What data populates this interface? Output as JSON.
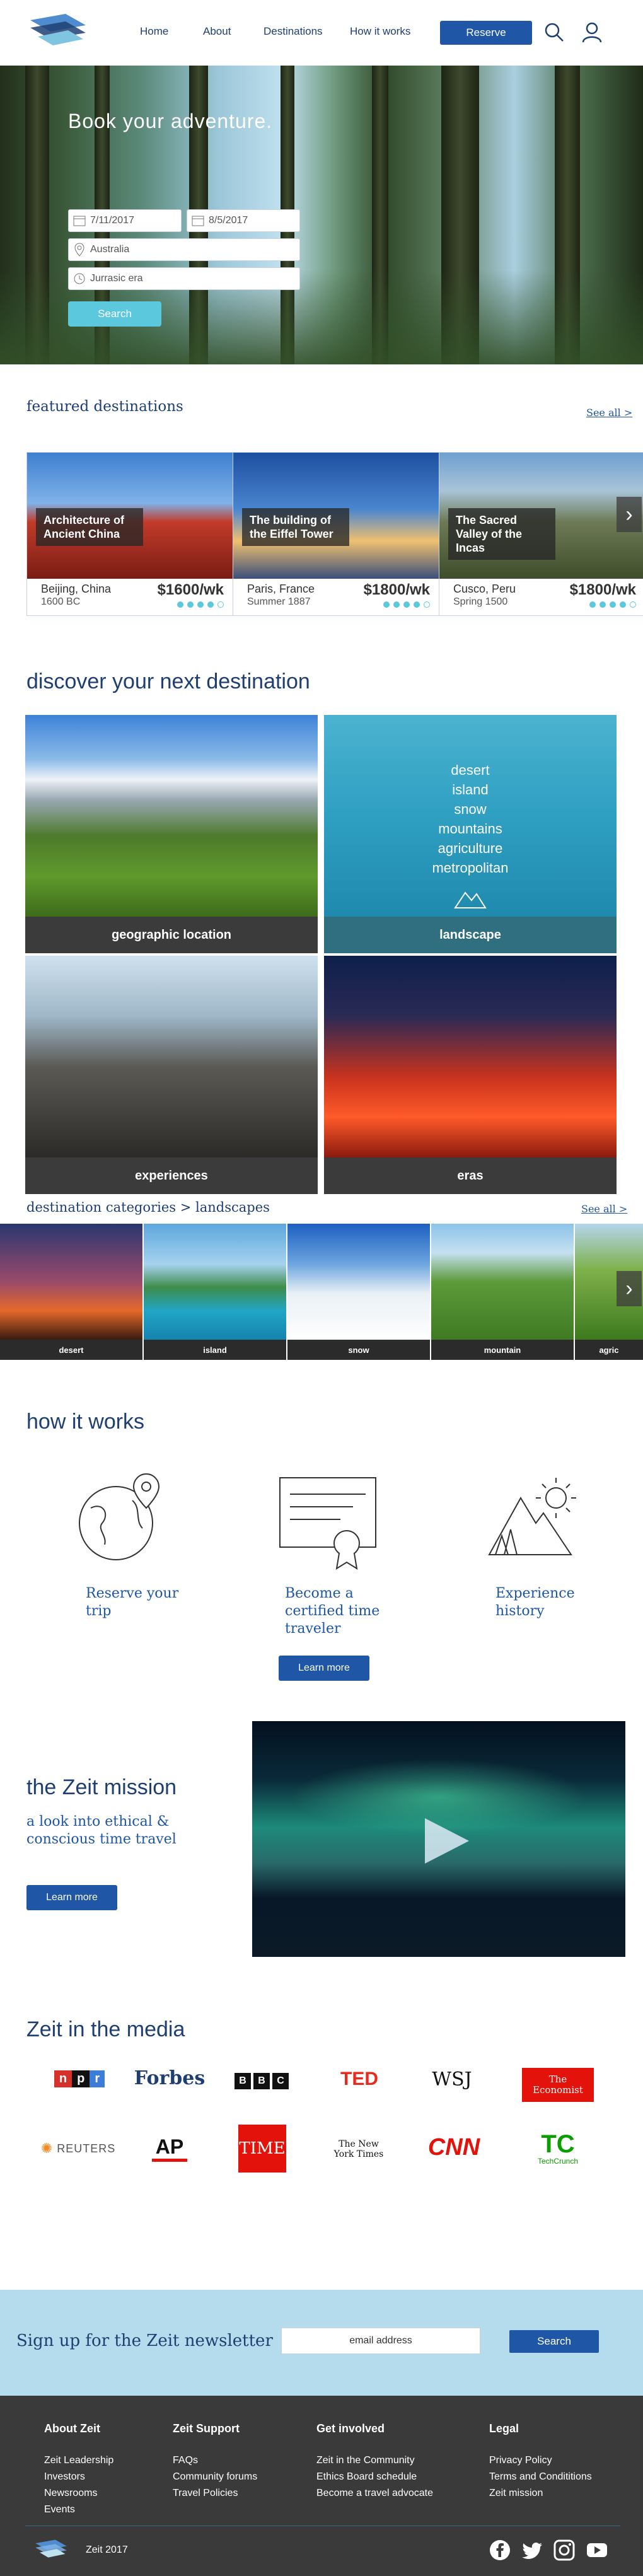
{
  "header": {
    "nav": [
      "Home",
      "About",
      "Destinations",
      "How it works"
    ],
    "reserve_label": "Reserve"
  },
  "hero": {
    "title": "Book your adventure.",
    "date_from": "7/11/2017",
    "date_to": "8/5/2017",
    "location_placeholder": "Australia",
    "era_placeholder": "Jurrasic era",
    "search_label": "Search"
  },
  "featured": {
    "heading": "featured destinations",
    "see_all": "See all >",
    "cards": [
      {
        "caption": "Architecture of Ancient China",
        "place": "Beijing, China",
        "era": "1600 BC",
        "price": "$1600/wk",
        "rating": 4,
        "rating_max": 5
      },
      {
        "caption": "The building of the Eiffel Tower",
        "place": "Paris, France",
        "era": "Summer 1887",
        "price": "$1800/wk",
        "rating": 4,
        "rating_max": 5
      },
      {
        "caption": "The Sacred Valley of the Incas",
        "place": "Cusco, Peru",
        "era": "Spring 1500",
        "price": "$1800/wk",
        "rating": 4,
        "rating_max": 5
      }
    ]
  },
  "discover": {
    "heading": "discover your next destination",
    "tiles": [
      "geographic location",
      "landscape",
      "experiences",
      "eras"
    ],
    "landscape_options": [
      "desert",
      "island",
      "snow",
      "mountains",
      "agriculture",
      "metropolitan"
    ]
  },
  "categories": {
    "breadcrumb": "destination categories > landscapes",
    "see_all": "See all >",
    "items": [
      "desert",
      "island",
      "snow",
      "mountain",
      "agric"
    ]
  },
  "how": {
    "heading": "how it works",
    "steps": [
      "Reserve your trip",
      "Become a certified time traveler",
      "Experience history"
    ],
    "learn_more": "Learn more"
  },
  "mission": {
    "heading": "the Zeit mission",
    "subheading": "a look into  ethical & conscious time travel",
    "learn_more": "Learn more"
  },
  "media": {
    "heading": "Zeit in the media",
    "logos": [
      "npr",
      "Forbes",
      "BBC",
      "TED",
      "WSJ",
      "The Economist",
      "REUTERS",
      "AP",
      "TIME",
      "The New York Times",
      "CNN",
      "TechCrunch"
    ]
  },
  "newsletter": {
    "heading": "Sign up for the Zeit newsletter",
    "email_placeholder": "email address",
    "search_label": "Search"
  },
  "footer": {
    "columns": [
      {
        "title": "About Zeit",
        "links": [
          "Zeit Leadership",
          "Investors",
          "Newsrooms",
          "Events"
        ]
      },
      {
        "title": "Zeit Support",
        "links": [
          "FAQs",
          "Community forums",
          "Travel Policies"
        ]
      },
      {
        "title": "Get involved",
        "links": [
          "Zeit in the Community",
          "Ethics Board schedule",
          "Become a travel advocate"
        ]
      },
      {
        "title": "Legal",
        "links": [
          "Privacy Policy",
          "Terms and Condititions",
          "Zeit mission"
        ]
      }
    ],
    "copyright": "Zeit 2017",
    "social": [
      "facebook-icon",
      "twitter-icon",
      "instagram-icon",
      "youtube-icon"
    ]
  },
  "colors": {
    "primary": "#1f57a6",
    "accent": "#5cc8dd",
    "newsletter_bg": "#b4dcec",
    "footer_bg": "#3a3a3a"
  }
}
